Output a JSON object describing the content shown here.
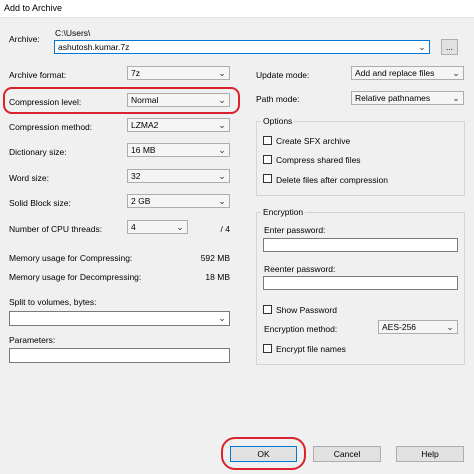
{
  "window": {
    "title": "Add to Archive"
  },
  "archive": {
    "label": "Archive:",
    "path": "C:\\Users\\",
    "value": "ashutosh.kumar.7z",
    "browse_label": "..."
  },
  "left": {
    "archive_format": {
      "label": "Archive format:",
      "value": "7z"
    },
    "compression_level": {
      "label": "Compression level:",
      "value": "Normal"
    },
    "compression_method": {
      "label": "Compression method:",
      "value": "LZMA2"
    },
    "dictionary_size": {
      "label": "Dictionary size:",
      "value": "16 MB"
    },
    "word_size": {
      "label": "Word size:",
      "value": "32"
    },
    "solid_block_size": {
      "label": "Solid Block size:",
      "value": "2 GB"
    },
    "cpu_threads": {
      "label": "Number of CPU threads:",
      "value": "4",
      "max": "/ 4"
    },
    "mem_compress": {
      "label": "Memory usage for Compressing:",
      "value": "592 MB"
    },
    "mem_decompress": {
      "label": "Memory usage for Decompressing:",
      "value": "18 MB"
    },
    "split_volumes": {
      "label": "Split to volumes, bytes:",
      "value": ""
    },
    "parameters": {
      "label": "Parameters:",
      "value": ""
    }
  },
  "right": {
    "update_mode": {
      "label": "Update mode:",
      "value": "Add and replace files"
    },
    "path_mode": {
      "label": "Path mode:",
      "value": "Relative pathnames"
    },
    "options": {
      "title": "Options",
      "items": [
        {
          "label": "Create SFX archive",
          "checked": false
        },
        {
          "label": "Compress shared files",
          "checked": false
        },
        {
          "label": "Delete files after compression",
          "checked": false
        }
      ]
    },
    "encryption": {
      "title": "Encryption",
      "enter_password_label": "Enter password:",
      "reenter_password_label": "Reenter password:",
      "show_password_label": "Show Password",
      "method_label": "Encryption method:",
      "method_value": "AES-256",
      "encrypt_names_label": "Encrypt file names"
    }
  },
  "buttons": {
    "ok": "OK",
    "cancel": "Cancel",
    "help": "Help"
  },
  "colors": {
    "highlight": "#d9232e",
    "dialog_bg": "#f0f0f0",
    "focus_border": "#0078d7"
  }
}
